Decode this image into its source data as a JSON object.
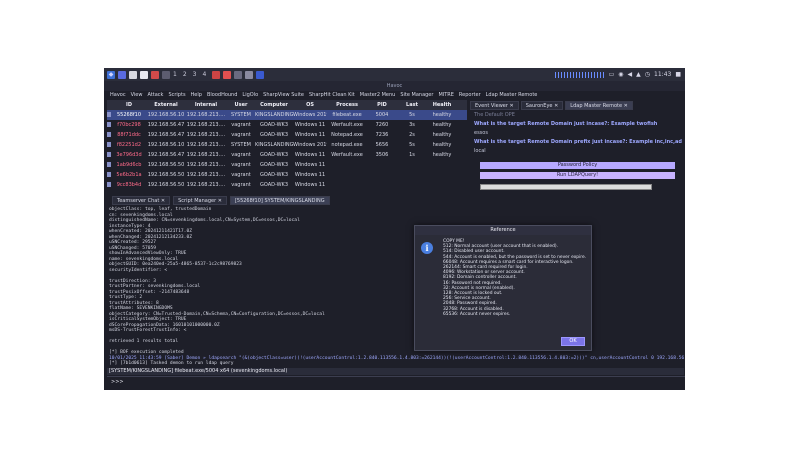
{
  "taskbar": {
    "workspaces": [
      "1",
      "2",
      "3",
      "4"
    ],
    "time": "11:43"
  },
  "window_title": "Havoc",
  "menu": [
    "Havoc",
    "View",
    "Attack",
    "Scripts",
    "Help",
    "BloodHound",
    "LigOlo",
    "SharpView Suite",
    "SharpHit Clean Kit",
    "Master2 Menu",
    "Site Manager",
    "MITRE",
    "Reporter",
    "Ldap Master Remote"
  ],
  "beacons": {
    "headers": [
      "ID",
      "External",
      "Internal",
      "User",
      "Computer",
      "OS",
      "Process",
      "PID",
      "Last",
      "Health"
    ],
    "rows": [
      [
        "55268f10",
        "192.168.56.10",
        "192.168.213.…",
        "SYSTEM",
        "KINGSLANDING",
        "Windows 2019 Server",
        "filebeat.exe",
        "5004",
        "5s",
        "healthy"
      ],
      [
        "f70bc298",
        "192.168.56.47",
        "192.168.213.…",
        "vagrant",
        "GOAD-WK3",
        "Windows 11",
        "Werfault.exe",
        "7260",
        "3s",
        "healthy"
      ],
      [
        "88f71ddc",
        "192.168.56.47",
        "192.168.213.…",
        "vagrant",
        "GOAD-WK3",
        "Windows 11",
        "Notepad.exe",
        "7236",
        "2s",
        "healthy"
      ],
      [
        "f82251d2",
        "192.168.56.10",
        "192.168.213.…",
        "SYSTEM",
        "KINGSLANDING",
        "Windows 2019 Server",
        "notepad.exe",
        "5656",
        "5s",
        "healthy"
      ],
      [
        "3e796d3d",
        "192.168.56.47",
        "192.168.213.…",
        "vagrant",
        "GOAD-WK3",
        "Windows 11",
        "Werfault.exe",
        "3506",
        "1s",
        "healthy"
      ],
      [
        "1ab9d6cb",
        "192.168.56.50",
        "192.168.213.…",
        "vagrant",
        "GOAD-WK3",
        "Windows 11",
        "",
        "",
        "",
        ""
      ],
      [
        "5e6b2b1a",
        "192.168.56.50",
        "192.168.213.…",
        "vagrant",
        "GOAD-WK3",
        "Windows 11",
        "",
        "",
        "",
        ""
      ],
      [
        "9cc83b4d",
        "192.168.56.50",
        "192.168.213.…",
        "vagrant",
        "GOAD-WK3",
        "Windows 11",
        "",
        "",
        "",
        ""
      ]
    ]
  },
  "right_tabs": [
    "Event Viewer",
    "SauronEye",
    "Ldap Master Remote"
  ],
  "right_panel": {
    "default": "The Default OPE",
    "q1": "What is the target Remote Domain just incase?: Example twofish",
    "a1": "essos",
    "q2": "What is the target Remote Domain prefix just incase?: Example inc,inc,ad",
    "a2": "local",
    "password_policy": "Password Policy",
    "run": "Run LDAPQuery!"
  },
  "bottom_tabs": [
    "Teamserver Chat",
    "Script Manager",
    "[55268f10] SYSTEM/KINGSLANDING"
  ],
  "console_lines": [
    "objectClass: top, leaf, trustedDomain",
    "cn: sevenkingdoms.local",
    "distinguishedName: CN=sevenkingdoms.local,CN=System,DC=essos,DC=local",
    "instanceType: 4",
    "whenCreated: 20241211421T17.0Z",
    "whenChanged: 20241212134233.0Z",
    "uSNCreated: 29527",
    "uSNChanged: 57059",
    "showInAdvancedViewOnly: TRUE",
    "name: sevenkingdoms.local",
    "objectGUID: 0ea240ed-25a5-4865-8537-1c2c98769823",
    "securityIdentifier: <",
    "",
    "trustDirection: 3",
    "trustPartner: sevenkingdoms.local",
    "trustPosixOffset: -2147483648",
    "trustType: 2",
    "trustAttributes: 8",
    "flatName: SEVENKINGDOMS",
    "objectCategory: CN=Trusted-Domain,CN=Schema,CN=Configuration,DC=essos,DC=local",
    "isCriticalSystemObject: TRUE",
    "dSCorePropagationData: 16010101000000.0Z",
    "msDS-TrustForestTrustInfo: <",
    "",
    "retrieved 1 results total",
    "",
    "[*] BOF execution completed"
  ],
  "console_cmd": "10/01/2025 11:43:59 [Saber] Demon » ldapsearch \"(&(objectClass=user)(!(userAccountControl:1.2.840.113556.1.4.803:=262144))(!(userAccountControl:1.2.840.113556.1.4.803:=2)))\" cn,userAccountControl 0 192.168.56.12 DC=essos,DC=local",
  "console_task": "[*] [7b1d0613] Tasked demon to run ldap query",
  "status": "[SYSTEM/KINGSLANDING] filebeat.exe/5004 x64 (sevenkingdoms.local)",
  "prompt": ">>>",
  "dialog": {
    "title": "Reference",
    "lines": [
      "COPY ME!",
      "512: Normal account (user account that is enabled).",
      "514: Disabled user account.",
      "544: Account is enabled, but the password is set to never expire.",
      "66048: Account requires a smart card for interactive logon.",
      "262144: Smart card required for login.",
      "4096: Workstation or server account.",
      "8192: Domain controller account.",
      "16: Password not required.",
      "32: Account is normal (enabled).",
      "128: Account is locked out.",
      "256: Service account.",
      "2048: Password expired.",
      "32768: Account is disabled.",
      "65536: Account never expires."
    ],
    "ok": "OK"
  }
}
